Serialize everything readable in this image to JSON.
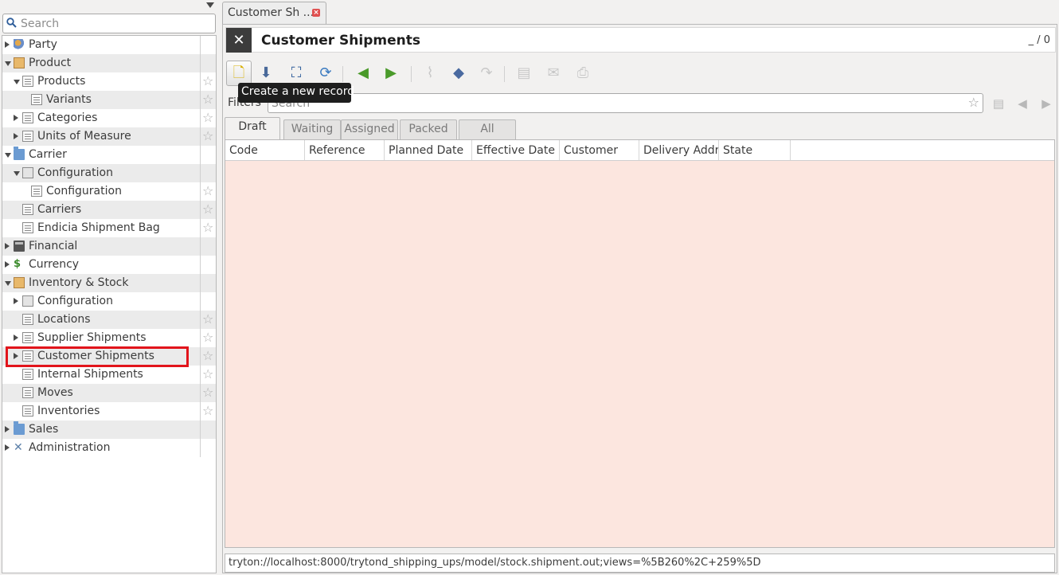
{
  "sidebar": {
    "search_placeholder": "Search",
    "items": [
      {
        "label": "Party",
        "icon": "party-icon",
        "level": 0,
        "expander": "closed",
        "star": false,
        "alt": false
      },
      {
        "label": "Product",
        "icon": "box-icon",
        "level": 0,
        "expander": "open",
        "star": false,
        "alt": true
      },
      {
        "label": "Products",
        "icon": "document-icon",
        "level": 1,
        "expander": "open",
        "star": true,
        "alt": false
      },
      {
        "label": "Variants",
        "icon": "document-icon",
        "level": 2,
        "expander": "none",
        "star": true,
        "alt": true
      },
      {
        "label": "Categories",
        "icon": "document-icon",
        "level": 1,
        "expander": "closed",
        "star": true,
        "alt": false
      },
      {
        "label": "Units of Measure",
        "icon": "document-icon",
        "level": 1,
        "expander": "closed",
        "star": true,
        "alt": true
      },
      {
        "label": "Carrier",
        "icon": "folder-icon",
        "level": 0,
        "expander": "open",
        "star": false,
        "alt": false
      },
      {
        "label": "Configuration",
        "icon": "config-icon",
        "level": 1,
        "expander": "open",
        "star": false,
        "alt": true
      },
      {
        "label": "Configuration",
        "icon": "document-icon",
        "level": 2,
        "expander": "none",
        "star": true,
        "alt": false
      },
      {
        "label": "Carriers",
        "icon": "document-icon",
        "level": 1,
        "expander": "none",
        "star": true,
        "alt": true
      },
      {
        "label": "Endicia Shipment Bag",
        "icon": "document-icon",
        "level": 1,
        "expander": "none",
        "star": true,
        "alt": false
      },
      {
        "label": "Financial",
        "icon": "calculator-icon",
        "level": 0,
        "expander": "closed",
        "star": false,
        "alt": true
      },
      {
        "label": "Currency",
        "icon": "money-icon",
        "level": 0,
        "expander": "closed",
        "star": false,
        "alt": false
      },
      {
        "label": "Inventory & Stock",
        "icon": "box-icon",
        "level": 0,
        "expander": "open",
        "star": false,
        "alt": true
      },
      {
        "label": "Configuration",
        "icon": "config-icon",
        "level": 1,
        "expander": "closed",
        "star": false,
        "alt": false
      },
      {
        "label": "Locations",
        "icon": "document-icon",
        "level": 1,
        "expander": "none",
        "star": true,
        "alt": true
      },
      {
        "label": "Supplier Shipments",
        "icon": "document-icon",
        "level": 1,
        "expander": "closed",
        "star": true,
        "alt": false
      },
      {
        "label": "Customer Shipments",
        "icon": "document-icon",
        "level": 1,
        "expander": "closed",
        "star": true,
        "alt": true
      },
      {
        "label": "Internal Shipments",
        "icon": "document-icon",
        "level": 1,
        "expander": "none",
        "star": true,
        "alt": false
      },
      {
        "label": "Moves",
        "icon": "document-icon",
        "level": 1,
        "expander": "none",
        "star": true,
        "alt": true
      },
      {
        "label": "Inventories",
        "icon": "document-icon",
        "level": 1,
        "expander": "none",
        "star": true,
        "alt": false
      },
      {
        "label": "Sales",
        "icon": "folder-icon",
        "level": 0,
        "expander": "closed",
        "star": false,
        "alt": true
      },
      {
        "label": "Administration",
        "icon": "tools-icon",
        "level": 0,
        "expander": "closed",
        "star": false,
        "alt": false
      }
    ]
  },
  "tab": {
    "label": "Customer Sh ...",
    "close_glyph": "×"
  },
  "form": {
    "title": "Customer Shipments",
    "record_count": "_ / 0",
    "tooltip": "Create a new record",
    "filters_label": "Filters",
    "filter_placeholder": "Search",
    "filter_tabs": [
      "Draft",
      "Waiting",
      "Assigned",
      "Packed",
      "All"
    ],
    "active_filter_tab": "Draft",
    "columns": [
      "Code",
      "Reference",
      "Planned Date",
      "Effective Date",
      "Customer",
      "Delivery Addr",
      "State"
    ],
    "status_url": "tryton://localhost:8000/trytond_shipping_ups/model/stock.shipment.out;views=%5B260%2C+259%5D"
  },
  "toolbar": {
    "buttons": [
      {
        "name": "new-record-button",
        "icon": "new-document-icon",
        "enabled": true
      },
      {
        "name": "save-button",
        "icon": "save-icon",
        "enabled": true
      },
      {
        "name": "switch-view-button",
        "icon": "fullscreen-icon",
        "enabled": true
      },
      {
        "name": "reload-button",
        "icon": "reload-icon",
        "enabled": true
      },
      {
        "name": "previous-button",
        "icon": "arrow-left-icon",
        "enabled": true
      },
      {
        "name": "next-button",
        "icon": "arrow-right-icon",
        "enabled": true
      },
      {
        "name": "attachment-button",
        "icon": "paperclip-icon",
        "enabled": false
      },
      {
        "name": "action-button",
        "icon": "diamond-icon",
        "enabled": true
      },
      {
        "name": "relate-button",
        "icon": "redo-icon",
        "enabled": false
      },
      {
        "name": "report-button",
        "icon": "report-icon",
        "enabled": false
      },
      {
        "name": "email-button",
        "icon": "email-icon",
        "enabled": false
      },
      {
        "name": "print-button",
        "icon": "printer-icon",
        "enabled": false
      }
    ]
  },
  "colors": {
    "grid_background": "#fce6df",
    "highlight_border": "#e2141b",
    "tooltip_background": "#1e1e1e"
  }
}
